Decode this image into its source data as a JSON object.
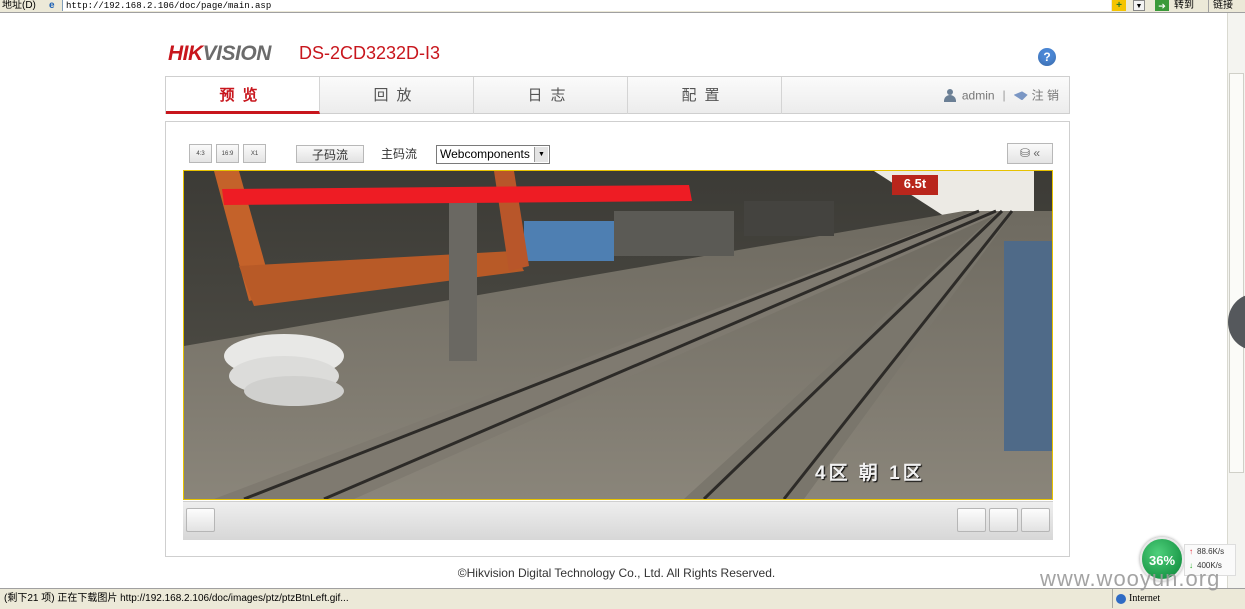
{
  "browser": {
    "address_label": "地址(D)",
    "url": "http://192.168.2.106/doc/page/main.asp",
    "go_label": "转到",
    "links_label": "链接",
    "status_message": "(剩下21 项) 正在下载图片 http://192.168.2.106/doc/images/ptz/ptzBtnLeft.gif...",
    "zone": "Internet"
  },
  "header": {
    "logo_hik": "HIK",
    "logo_vision": "VISION",
    "model": "DS-2CD3232D-I3",
    "help_symbol": "?"
  },
  "nav": {
    "tabs": [
      {
        "label": "预览",
        "active": true
      },
      {
        "label": "回放",
        "active": false
      },
      {
        "label": "日志",
        "active": false
      },
      {
        "label": "配置",
        "active": false
      }
    ],
    "user": "admin",
    "separator": "|",
    "logout": "注 销"
  },
  "toolbar": {
    "ratio_buttons": [
      "4:3",
      "16:9",
      "X1"
    ],
    "substream_label": "子码流",
    "mainstream_label": "主码流",
    "plugin_select_value": "Webcomponents",
    "ptz_toggle_symbol": "«"
  },
  "video": {
    "osd_text": "4区 朝 1区",
    "sign_text": "6.5t"
  },
  "footer": {
    "copyright": "©Hikvision Digital Technology Co., Ltd. All Rights Reserved."
  },
  "net_widget": {
    "percent": "36%",
    "upload": "88.6K/s",
    "download": "400K/s"
  },
  "watermark": "www.wooyun.org",
  "colors": {
    "brand_red": "#c8161d",
    "video_border": "#e7c200"
  }
}
